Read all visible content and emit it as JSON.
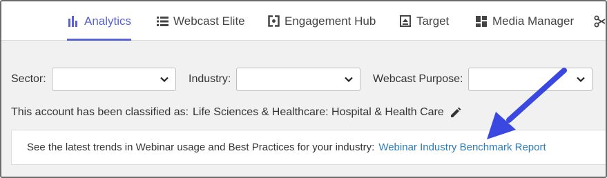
{
  "nav": {
    "items": [
      {
        "label": "Analytics",
        "icon": "bar-chart-icon",
        "active": true
      },
      {
        "label": "Webcast Elite",
        "icon": "list-icon",
        "active": false
      },
      {
        "label": "Engagement Hub",
        "icon": "hub-icon",
        "active": false
      },
      {
        "label": "Target",
        "icon": "target-icon",
        "active": false
      },
      {
        "label": "Media Manager",
        "icon": "grid-icon",
        "active": false
      }
    ],
    "accent_color": "#5662d6"
  },
  "filters": {
    "sector_label": "Sector:",
    "sector_value": "",
    "industry_label": "Industry:",
    "industry_value": "",
    "purpose_label": "Webcast Purpose:",
    "purpose_value": ""
  },
  "classification": {
    "prefix": "This account has been classified as:",
    "value": "Life Sciences & Healthcare: Hospital & Health Care",
    "edit_icon": "pencil-icon"
  },
  "banner": {
    "text": "See the latest trends in Webinar usage and Best Practices for your industry:",
    "link_label": "Webinar Industry Benchmark Report",
    "link_color": "#2d7bb6"
  },
  "annotation": {
    "arrow_color": "#3a47e0"
  }
}
